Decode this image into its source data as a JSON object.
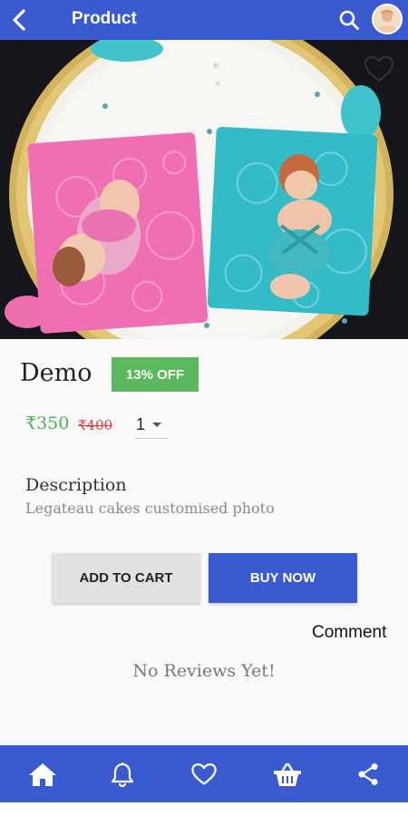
{
  "appbar": {
    "title": "Product",
    "back_icon": "arrow-left-icon",
    "search_icon": "search-icon",
    "avatar_icon": "user-avatar-icon"
  },
  "product": {
    "name": "Demo",
    "discount_badge": "13% OFF",
    "price": "₹350",
    "mrp": "₹400",
    "quantity": "1",
    "favorite_icon": "heart-outline-icon"
  },
  "description": {
    "title": "Description",
    "text": "Legateau cakes customised  photo"
  },
  "actions": {
    "add_to_cart": "ADD TO CART",
    "buy_now": "BUY NOW"
  },
  "reviews": {
    "comment_label": "Comment",
    "empty_text": "No Reviews Yet!"
  },
  "bottom_nav": {
    "items": [
      {
        "icon": "home-icon"
      },
      {
        "icon": "bell-icon"
      },
      {
        "icon": "heart-icon"
      },
      {
        "icon": "basket-icon"
      },
      {
        "icon": "share-icon"
      }
    ]
  },
  "colors": {
    "primary": "#3a5bd0",
    "discount_green": "#5cb85c",
    "price_green": "#47b24b",
    "mrp_red": "#e53935"
  }
}
